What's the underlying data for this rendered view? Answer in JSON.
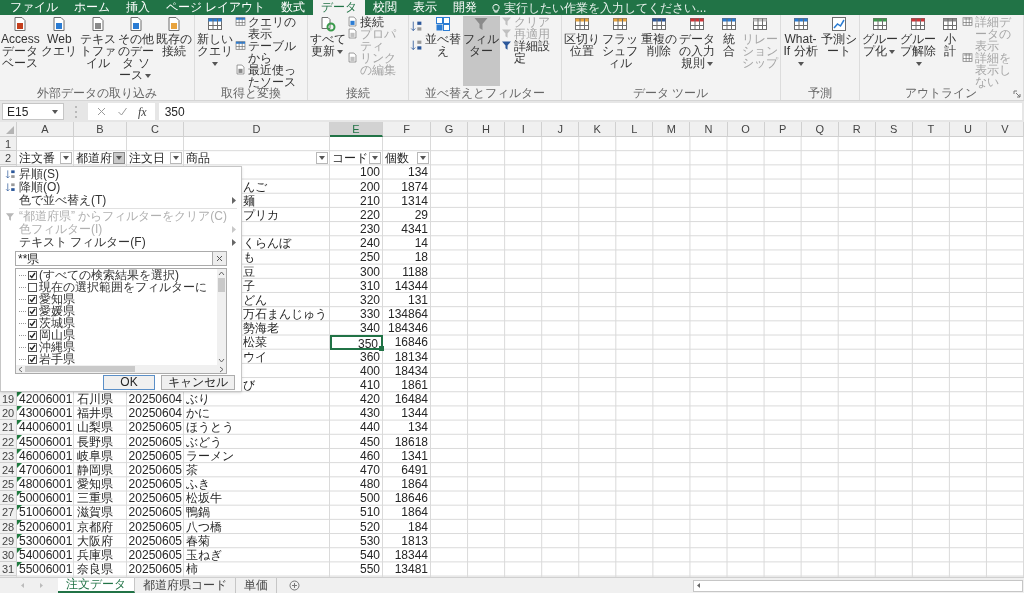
{
  "menu_tabs": [
    {
      "label": "ファイル",
      "selected": false
    },
    {
      "label": "ホーム",
      "selected": false
    },
    {
      "label": "挿入",
      "selected": false
    },
    {
      "label": "ページ レイアウト",
      "selected": false
    },
    {
      "label": "数式",
      "selected": false
    },
    {
      "label": "データ",
      "selected": true
    },
    {
      "label": "校閲",
      "selected": false
    },
    {
      "label": "表示",
      "selected": false
    },
    {
      "label": "開発",
      "selected": false
    }
  ],
  "tell_me": {
    "placeholder": "実行したい作業を入力してください..."
  },
  "ribbon": {
    "groups": [
      {
        "label": "外部データの取り込み",
        "items": [
          {
            "kind": "large",
            "label": "Access データベース",
            "dropdown": false,
            "pressed": false,
            "disabled": false
          },
          {
            "kind": "large",
            "label": "Web クエリ",
            "dropdown": false,
            "pressed": false,
            "disabled": false
          },
          {
            "kind": "large",
            "label": "テキストファイル",
            "dropdown": false,
            "pressed": false,
            "disabled": false
          },
          {
            "kind": "large",
            "label": "その他のデータ ソース",
            "dropdown": true,
            "pressed": false,
            "disabled": false
          },
          {
            "kind": "large",
            "label": "既存の接続",
            "dropdown": false,
            "pressed": false,
            "disabled": false
          }
        ]
      },
      {
        "label": "取得と変換",
        "items": [
          {
            "kind": "large",
            "label": "新しいクエリ",
            "dropdown": true,
            "pressed": false,
            "disabled": false
          },
          {
            "kind": "stack",
            "items": [
              {
                "label": "クエリの表示",
                "disabled": false
              },
              {
                "label": "テーブルから",
                "disabled": false
              },
              {
                "label": "最近使ったソース",
                "disabled": false
              }
            ]
          }
        ]
      },
      {
        "label": "接続",
        "items": [
          {
            "kind": "large",
            "label": "すべて更新",
            "dropdown": true,
            "pressed": false,
            "disabled": false
          },
          {
            "kind": "stack",
            "items": [
              {
                "label": "接続",
                "disabled": false
              },
              {
                "label": "プロパティ",
                "disabled": true
              },
              {
                "label": "リンクの編集",
                "disabled": true
              }
            ]
          }
        ]
      },
      {
        "label": "並べ替えとフィルター",
        "items": [
          {
            "kind": "sort_buttons"
          },
          {
            "kind": "large",
            "label": "並べ替え",
            "dropdown": false,
            "pressed": false,
            "disabled": false
          },
          {
            "kind": "large",
            "label": "フィルター",
            "dropdown": false,
            "pressed": true,
            "disabled": false
          },
          {
            "kind": "stack",
            "items": [
              {
                "label": "クリア",
                "disabled": true
              },
              {
                "label": "再適用",
                "disabled": true
              },
              {
                "label": "詳細設定",
                "disabled": false
              }
            ]
          }
        ]
      },
      {
        "label": "データ ツール",
        "items": [
          {
            "kind": "large",
            "label": "区切り位置",
            "dropdown": false,
            "pressed": false,
            "disabled": false
          },
          {
            "kind": "large",
            "label": "フラッシュフィル",
            "dropdown": false,
            "pressed": false,
            "disabled": false
          },
          {
            "kind": "large",
            "label": "重複の削除",
            "dropdown": false,
            "pressed": false,
            "disabled": false
          },
          {
            "kind": "large",
            "label": "データの入力規則",
            "dropdown": true,
            "pressed": false,
            "disabled": false
          },
          {
            "kind": "large",
            "label": "統合",
            "dropdown": false,
            "pressed": false,
            "disabled": false
          },
          {
            "kind": "large",
            "label": "リレーションシップ",
            "dropdown": false,
            "pressed": false,
            "disabled": true
          }
        ]
      },
      {
        "label": "予測",
        "items": [
          {
            "kind": "large",
            "label": "What-If 分析",
            "dropdown": true,
            "pressed": false,
            "disabled": false
          },
          {
            "kind": "large",
            "label": "予測シート",
            "dropdown": false,
            "pressed": false,
            "disabled": false
          }
        ]
      },
      {
        "label": "アウトライン",
        "launcher": true,
        "items": [
          {
            "kind": "large",
            "label": "グループ化",
            "dropdown": true,
            "pressed": false,
            "disabled": false
          },
          {
            "kind": "large",
            "label": "グループ解除",
            "dropdown": true,
            "pressed": false,
            "disabled": false
          },
          {
            "kind": "large",
            "label": "小計",
            "dropdown": false,
            "pressed": false,
            "disabled": false
          },
          {
            "kind": "stack",
            "items": [
              {
                "label": "詳細データの表示",
                "disabled": true
              },
              {
                "label": "詳細を表示しない",
                "disabled": true
              }
            ]
          }
        ]
      }
    ]
  },
  "formula_bar": {
    "name_box": "E15",
    "insert_function": "fx",
    "value": "350"
  },
  "sheet": {
    "columns": [
      "A",
      "B",
      "C",
      "D",
      "E",
      "F",
      "G",
      "H",
      "I",
      "J",
      "K",
      "L",
      "M",
      "N",
      "O",
      "P",
      "Q",
      "R",
      "S",
      "T",
      "U",
      "V"
    ],
    "blank_rows": [
      {
        "number": "1"
      }
    ],
    "header_row": {
      "number": "2",
      "cells": [
        {
          "label": "注文番",
          "filter_open": false
        },
        {
          "label": "都道府",
          "filter_open": true
        },
        {
          "label": "注文日",
          "filter_open": false
        },
        {
          "label": "商品",
          "filter_open": false
        },
        {
          "label": "コード",
          "filter_open": false
        },
        {
          "label": "個数",
          "filter_open": false
        }
      ]
    },
    "rows": [
      {
        "code": "100",
        "qty": "134",
        "code_selected": false
      },
      {
        "product": "んご",
        "code": "200",
        "qty": "1874",
        "code_selected": false
      },
      {
        "product": "麺",
        "code": "210",
        "qty": "1314",
        "code_selected": false
      },
      {
        "product": "プリカ",
        "code": "220",
        "qty": "29",
        "code_selected": false
      },
      {
        "code": "230",
        "qty": "4341",
        "code_selected": false
      },
      {
        "product": "くらんぼ",
        "code": "240",
        "qty": "14",
        "code_selected": false
      },
      {
        "product": "も",
        "code": "250",
        "qty": "18",
        "code_selected": false
      },
      {
        "product": "豆",
        "code": "300",
        "qty": "1188",
        "code_selected": false
      },
      {
        "product": "子",
        "code": "310",
        "qty": "14344",
        "code_selected": false
      },
      {
        "product": "どん",
        "code": "320",
        "qty": "131",
        "code_selected": false
      },
      {
        "product": "万石まんじゅう",
        "code": "330",
        "qty": "134864",
        "code_selected": false
      },
      {
        "product": "勢海老",
        "code": "340",
        "qty": "184346",
        "code_selected": false
      },
      {
        "product": "松菜",
        "code": "350",
        "qty": "16846",
        "code_selected": true
      },
      {
        "product": "ウイ",
        "code": "360",
        "qty": "18134",
        "code_selected": false
      },
      {
        "code": "400",
        "qty": "18434",
        "code_selected": false
      },
      {
        "product": "び",
        "code": "410",
        "qty": "1861",
        "code_selected": false
      },
      {
        "number": "19",
        "order_no": "42006001",
        "prefecture": "石川県",
        "date": "20250604",
        "product": "ぶり",
        "code": "420",
        "qty": "16484",
        "code_selected": false,
        "flagged": true
      },
      {
        "number": "20",
        "order_no": "43006001",
        "prefecture": "福井県",
        "date": "20250604",
        "product": "かに",
        "code": "430",
        "qty": "1344",
        "code_selected": false,
        "flagged": true
      },
      {
        "number": "21",
        "order_no": "44006001",
        "prefecture": "山梨県",
        "date": "20250605",
        "product": "ほうとう",
        "code": "440",
        "qty": "134",
        "code_selected": false,
        "flagged": true
      },
      {
        "number": "22",
        "order_no": "45006001",
        "prefecture": "長野県",
        "date": "20250605",
        "product": "ぶどう",
        "code": "450",
        "qty": "18618",
        "code_selected": false,
        "flagged": true
      },
      {
        "number": "23",
        "order_no": "46006001",
        "prefecture": "岐阜県",
        "date": "20250605",
        "product": "ラーメン",
        "code": "460",
        "qty": "1341",
        "code_selected": false,
        "flagged": true
      },
      {
        "number": "24",
        "order_no": "47006001",
        "prefecture": "静岡県",
        "date": "20250605",
        "product": "茶",
        "code": "470",
        "qty": "6491",
        "code_selected": false,
        "flagged": true
      },
      {
        "number": "25",
        "order_no": "48006001",
        "prefecture": "愛知県",
        "date": "20250605",
        "product": "ふき",
        "code": "480",
        "qty": "1864",
        "code_selected": false,
        "flagged": true
      },
      {
        "number": "26",
        "order_no": "50006001",
        "prefecture": "三重県",
        "date": "20250605",
        "product": "松坂牛",
        "code": "500",
        "qty": "18646",
        "code_selected": false,
        "flagged": true
      },
      {
        "number": "27",
        "order_no": "51006001",
        "prefecture": "滋賀県",
        "date": "20250605",
        "product": "鴨鍋",
        "code": "510",
        "qty": "1864",
        "code_selected": false,
        "flagged": true
      },
      {
        "number": "28",
        "order_no": "52006001",
        "prefecture": "京都府",
        "date": "20250605",
        "product": "八つ橋",
        "code": "520",
        "qty": "184",
        "code_selected": false,
        "flagged": true
      },
      {
        "number": "29",
        "order_no": "53006001",
        "prefecture": "大阪府",
        "date": "20250605",
        "product": "春菊",
        "code": "530",
        "qty": "1813",
        "code_selected": false,
        "flagged": true
      },
      {
        "number": "30",
        "order_no": "54006001",
        "prefecture": "兵庫県",
        "date": "20250605",
        "product": "玉ねぎ",
        "code": "540",
        "qty": "18344",
        "code_selected": false,
        "flagged": true
      },
      {
        "number": "31",
        "order_no": "55006001",
        "prefecture": "奈良県",
        "date": "20250605",
        "product": "柿",
        "code": "550",
        "qty": "13481",
        "code_selected": false,
        "flagged": true
      }
    ]
  },
  "filter_menu": {
    "menu_items": [
      {
        "kind": "sort_ascending",
        "label": "昇順(S)",
        "disabled": false,
        "submenu": false
      },
      {
        "kind": "sort_descending",
        "label": "降順(O)",
        "disabled": false,
        "submenu": false
      },
      {
        "kind": "plain",
        "label": "色で並べ替え(T)",
        "disabled": false,
        "submenu": true
      },
      {
        "kind": "clear_filter",
        "label": "“都道府県” からフィルターをクリア(C)",
        "disabled": true,
        "submenu": false
      },
      {
        "kind": "plain",
        "label": "色フィルター(I)",
        "disabled": true,
        "submenu": true
      },
      {
        "kind": "plain",
        "label": "テキスト フィルター(F)",
        "disabled": false,
        "submenu": true
      }
    ],
    "search": {
      "value": "**県"
    },
    "options": [
      {
        "label": "(すべての検索結果を選択)",
        "checked": true
      },
      {
        "label": "現在の選択範囲をフィルターに",
        "checked": false
      },
      {
        "label": "愛知県",
        "checked": true
      },
      {
        "label": "愛媛県",
        "checked": true
      },
      {
        "label": "茨城県",
        "checked": true
      },
      {
        "label": "岡山県",
        "checked": true
      },
      {
        "label": "沖縄県",
        "checked": true
      },
      {
        "label": "岩手県",
        "checked": true
      }
    ],
    "buttons": [
      {
        "label": "OK",
        "default": true
      },
      {
        "label": "キャンセル",
        "default": false
      }
    ]
  },
  "sheet_tabs": [
    {
      "label": "注文データ",
      "selected": true
    },
    {
      "label": "都道府県コード",
      "selected": false
    },
    {
      "label": "単価",
      "selected": false
    }
  ]
}
